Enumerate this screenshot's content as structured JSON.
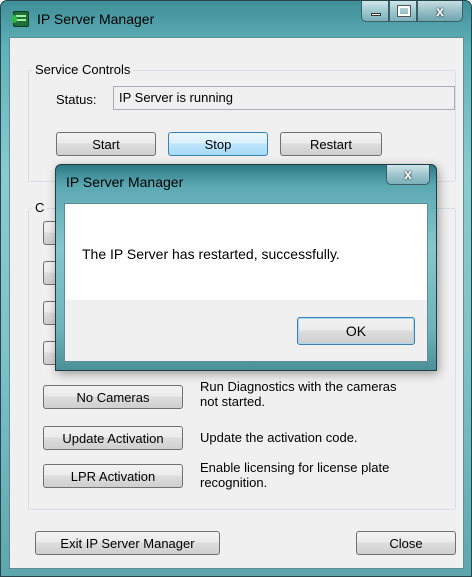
{
  "window": {
    "title": "IP Server Manager",
    "controls": {
      "minimize": "–",
      "maximize": "□",
      "close": "x"
    }
  },
  "service_controls": {
    "group_label": "Service Controls",
    "status_label": "Status:",
    "status_value": "IP Server is running",
    "buttons": {
      "start": "Start",
      "stop": "Stop",
      "restart": "Restart"
    }
  },
  "second_group": {
    "group_label_partial": "C",
    "actions": [
      {
        "button": "No Cameras",
        "desc_line1": "Run Diagnostics with the cameras",
        "desc_line2": "not started."
      },
      {
        "button": "Update Activation",
        "desc_line1": "Update the activation code.",
        "desc_line2": ""
      },
      {
        "button": "LPR Activation",
        "desc_line1": "Enable licensing for license plate",
        "desc_line2": "recognition."
      }
    ]
  },
  "footer": {
    "exit_button": "Exit IP Server Manager",
    "close_button": "Close"
  },
  "dialog": {
    "title": "IP Server Manager",
    "close": "x",
    "message": "The IP Server has restarted, successfully.",
    "ok_button": "OK"
  }
}
